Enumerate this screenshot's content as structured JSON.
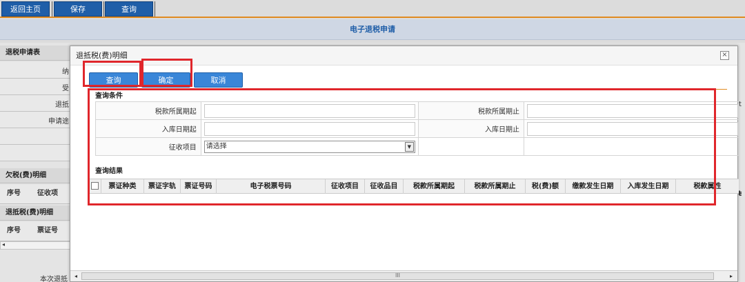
{
  "toolbar": {
    "back_label": "返回主页",
    "save_label": "保存",
    "query_label": "查询"
  },
  "page": {
    "title": "电子退税申请"
  },
  "background": {
    "section1": "退税申请表",
    "rows": [
      "纳",
      "受",
      "退抵",
      "申请途",
      "",
      ""
    ],
    "section2": "欠税(费)明细",
    "cols2": [
      "序号",
      "征收项"
    ],
    "section3": "退抵税(费)明细",
    "cols3": [
      "序号",
      "票证号"
    ],
    "footer_label": "本次退抵",
    "right_edge_1": "t",
    "right_edge_2": "ŧ"
  },
  "dialog": {
    "title": "退抵税(费)明细",
    "close_glyph": "×",
    "btn_query": "查询",
    "btn_confirm": "确定",
    "btn_cancel": "取消",
    "cond_label": "查询条件",
    "result_label": "查询结果",
    "conditions": {
      "tax_period_start": "税款所属期起",
      "tax_period_end": "税款所属期止",
      "store_date_start": "入库日期起",
      "store_date_end": "入库日期止",
      "levy_item": "征收项目",
      "select_placeholder": "请选择"
    },
    "columns": [
      "票证种类",
      "票证字轨",
      "票证号码",
      "电子税票号码",
      "征收项目",
      "征收品目",
      "税款所属期起",
      "税款所属期止",
      "税(费)额",
      "缴款发生日期",
      "入库发生日期",
      "税款属性"
    ],
    "scroll_thumb": "III"
  },
  "colors": {
    "toolbar_btn": "#1f5ea8",
    "dialog_btn": "#3a86d8",
    "highlight": "#e0262b",
    "accent_line": "#e08a1e"
  }
}
